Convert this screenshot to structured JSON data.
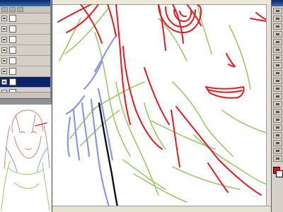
{
  "layers_panel": {
    "title": "",
    "layers": [
      {
        "name": "",
        "visible": true,
        "selected": false
      },
      {
        "name": "",
        "visible": true,
        "selected": false
      },
      {
        "name": "",
        "visible": true,
        "selected": false
      },
      {
        "name": "",
        "visible": true,
        "selected": false
      },
      {
        "name": "",
        "visible": true,
        "selected": false
      },
      {
        "name": "",
        "visible": true,
        "selected": false
      },
      {
        "name": "",
        "visible": true,
        "selected": true
      },
      {
        "name": "",
        "visible": true,
        "selected": false
      }
    ]
  },
  "tools_palette": {
    "tools": [
      "move-tool",
      "marquee-tool",
      "lasso-tool",
      "wand-tool",
      "crop-tool",
      "pen-tool",
      "brush-tool",
      "eraser-tool",
      "fill-tool",
      "text-tool",
      "hand-tool",
      "zoom-tool",
      "eyedropper-tool",
      "shape-tool",
      "path-tool",
      "blur-tool",
      "dodge-tool",
      "smudge-tool",
      "gradient-tool",
      "stamp-tool"
    ],
    "foreground_color": "#ff0000",
    "background_color": "#ffffff"
  },
  "colors": {
    "line_red": "#e31b23",
    "line_green": "#9cc86a",
    "line_blue": "#8d97e0",
    "line_black": "#111111",
    "ui_gray": "#d4d0c8",
    "titlebar_blue": "#0a246a"
  }
}
